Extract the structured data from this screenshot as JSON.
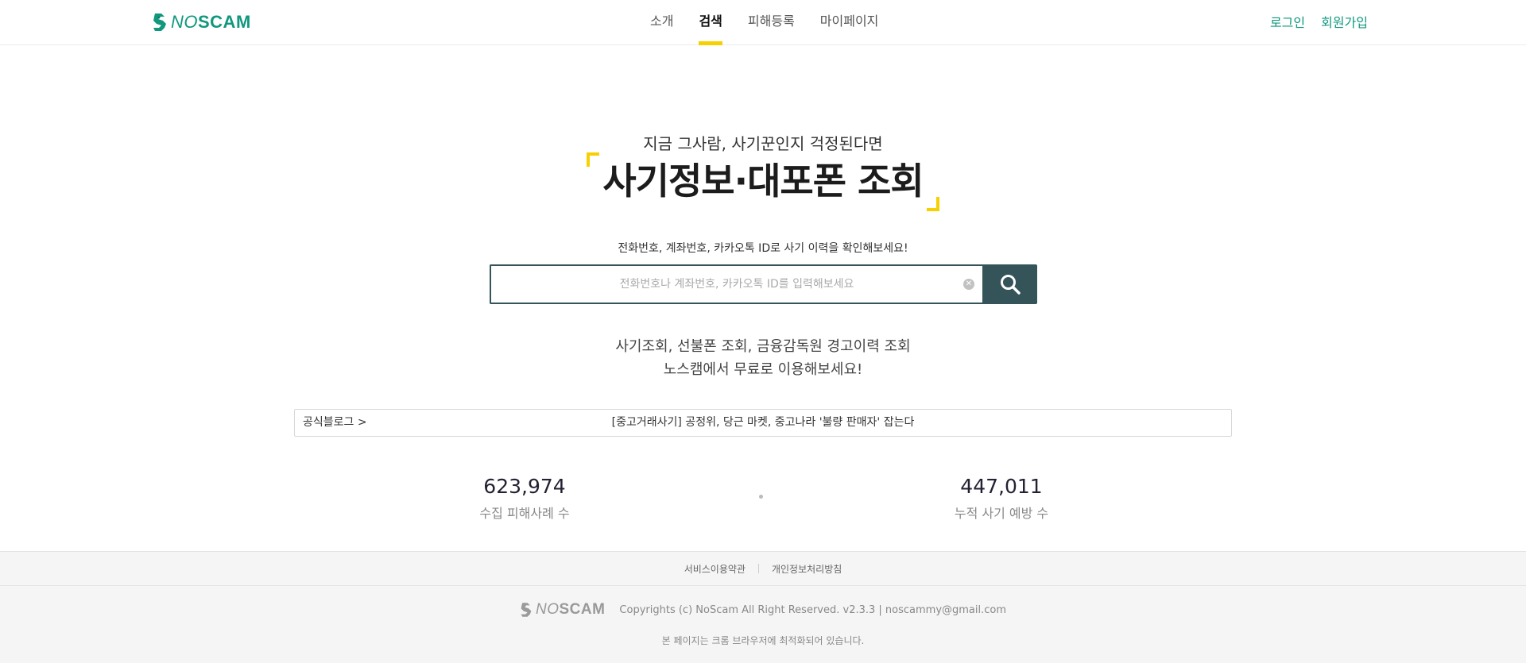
{
  "header": {
    "logo": {
      "no": "NO",
      "scam": "SCAM"
    },
    "nav": [
      {
        "label": "소개"
      },
      {
        "label": "검색"
      },
      {
        "label": "피해등록"
      },
      {
        "label": "마이페이지"
      }
    ],
    "login_label": "로그인",
    "signup_label": "회원가입"
  },
  "hero": {
    "subtitle": "지금 그사람, 사기꾼인지 걱정된다면",
    "title": "사기정보·대포폰 조회"
  },
  "search": {
    "hint": "전화번호, 계좌번호, 카카오톡 ID로 사기 이력을 확인해보세요!",
    "value": "",
    "placeholder": "전화번호나 계좌번호, 카카오톡 ID를 입력해보세요",
    "clear_glyph": "✕"
  },
  "promo": {
    "line1": "사기조회, 선불폰 조회, 금융감독원 경고이력 조회",
    "line2": "노스캠에서 무료로 이용해보세요!"
  },
  "blog": {
    "label": "공식블로그  >",
    "headline": "[중고거래사기] 공정위, 당근 마켓, 중고나라 '불량 판매자' 잡는다"
  },
  "stats": {
    "collected": {
      "value": "623,974",
      "label": "수집 피해사례 수"
    },
    "prevented": {
      "value": "447,011",
      "label": "누적 사기 예방 수"
    }
  },
  "footer": {
    "terms_label": "서비스이용약관",
    "privacy_label": "개인정보처리방침",
    "copyright": "Copyrights (c) NoScam All Right Reserved. v2.3.3 | noscammy@gmail.com",
    "browser_note": "본 페이지는 크롬 브라우저에 최적화되어 있습니다."
  },
  "colors": {
    "brand_green": "#10987e",
    "accent_yellow": "#f6d000",
    "search_dark": "#34545a"
  },
  "icons": {
    "logo": "noscam-logo-icon",
    "search": "magnifier-icon",
    "clear": "clear-circle-icon"
  }
}
